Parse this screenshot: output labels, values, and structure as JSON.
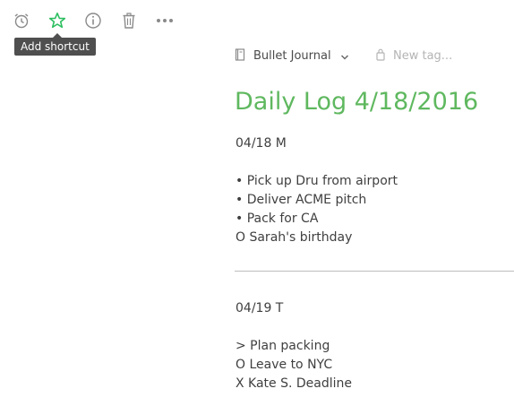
{
  "toolbar": {
    "icons": [
      "alarm-clock-icon",
      "star-icon",
      "info-icon",
      "trash-icon",
      "more-icon"
    ],
    "tooltip": "Add shortcut",
    "accent": "#2dbe60"
  },
  "header": {
    "notebook": "Bullet Journal",
    "tag_placeholder": "New tag..."
  },
  "note": {
    "title": "Daily Log 4/18/2016",
    "title_color": "#5fb85f",
    "section1": {
      "date": "04/18 M",
      "items": [
        "• Pick up Dru from airport",
        "• Deliver ACME pitch",
        "• Pack for CA",
        "O Sarah's birthday"
      ]
    },
    "section2": {
      "date": "04/19 T",
      "items": [
        "> Plan packing",
        "O Leave to NYC",
        "X Kate S. Deadline"
      ]
    }
  }
}
